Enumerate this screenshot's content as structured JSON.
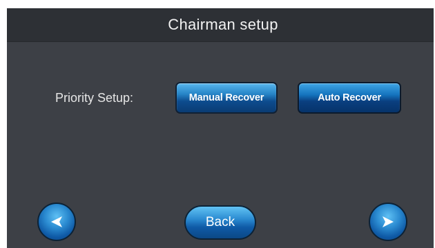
{
  "header": {
    "title": "Chairman setup"
  },
  "priority": {
    "label": "Priority Setup:",
    "manual_label": "Manual Recover",
    "auto_label": "Auto Recover"
  },
  "footer": {
    "back_label": "Back",
    "prev_icon": "arrow-left-icon",
    "next_icon": "arrow-right-icon"
  },
  "colors": {
    "background": "#3d4046",
    "title_bar": "#2d3035",
    "button_blue": "#1473bd"
  }
}
